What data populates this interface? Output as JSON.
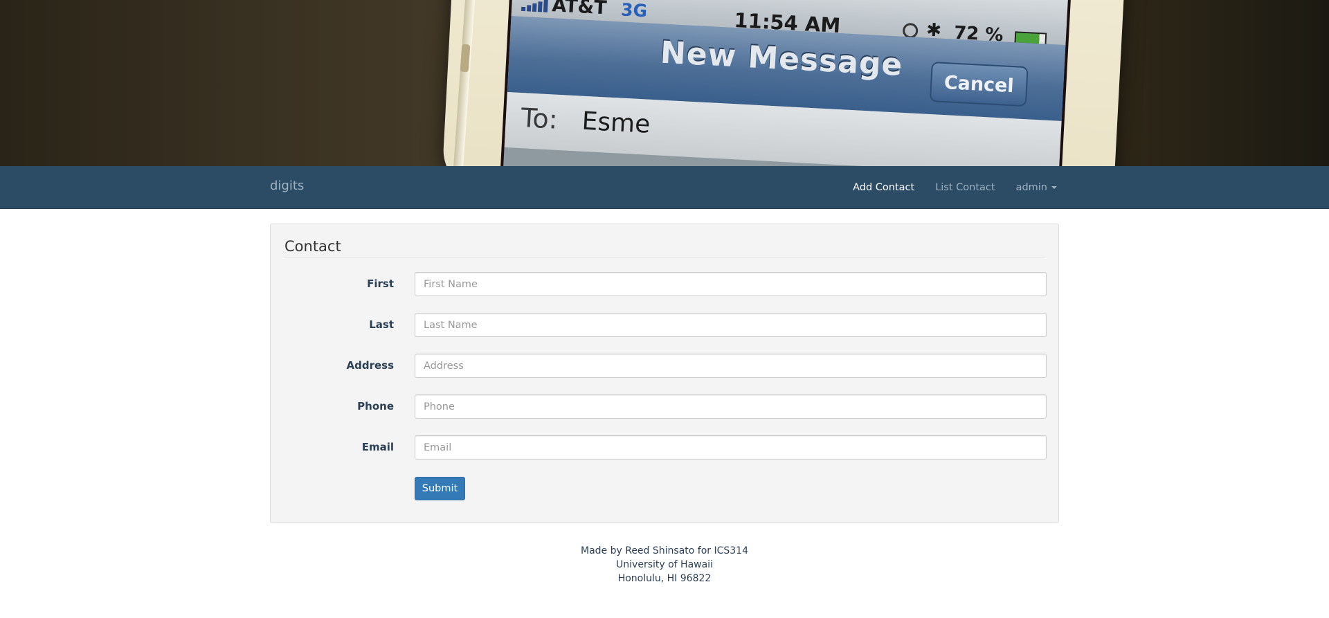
{
  "hero": {
    "carrier": "AT&T",
    "network": "3G",
    "time": "11:54 AM",
    "battery": "72 %",
    "screen_title": "New Message",
    "cancel_label": "Cancel",
    "to_label": "To:",
    "to_value": "Esme"
  },
  "navbar": {
    "brand": "digits",
    "items": [
      {
        "label": "Add Contact",
        "active": true
      },
      {
        "label": "List Contact",
        "active": false
      },
      {
        "label": "admin",
        "active": false,
        "dropdown": true
      }
    ]
  },
  "form": {
    "title": "Contact",
    "fields": [
      {
        "label": "First",
        "placeholder": "First Name",
        "value": ""
      },
      {
        "label": "Last",
        "placeholder": "Last Name",
        "value": ""
      },
      {
        "label": "Address",
        "placeholder": "Address",
        "value": ""
      },
      {
        "label": "Phone",
        "placeholder": "Phone",
        "value": ""
      },
      {
        "label": "Email",
        "placeholder": "Email",
        "value": ""
      }
    ],
    "submit_label": "Submit"
  },
  "footer": {
    "lines": [
      "Made by Reed Shinsato for ICS314",
      "University of Hawaii",
      "Honolulu, HI 96822"
    ]
  },
  "colors": {
    "navbar_bg": "#2c4b64",
    "primary_button": "#337ab7",
    "panel_bg": "#f4f4f4"
  },
  "icons": [
    "signal-icon",
    "bluetooth-icon",
    "alarm-icon",
    "battery-icon",
    "caret-down-icon"
  ]
}
